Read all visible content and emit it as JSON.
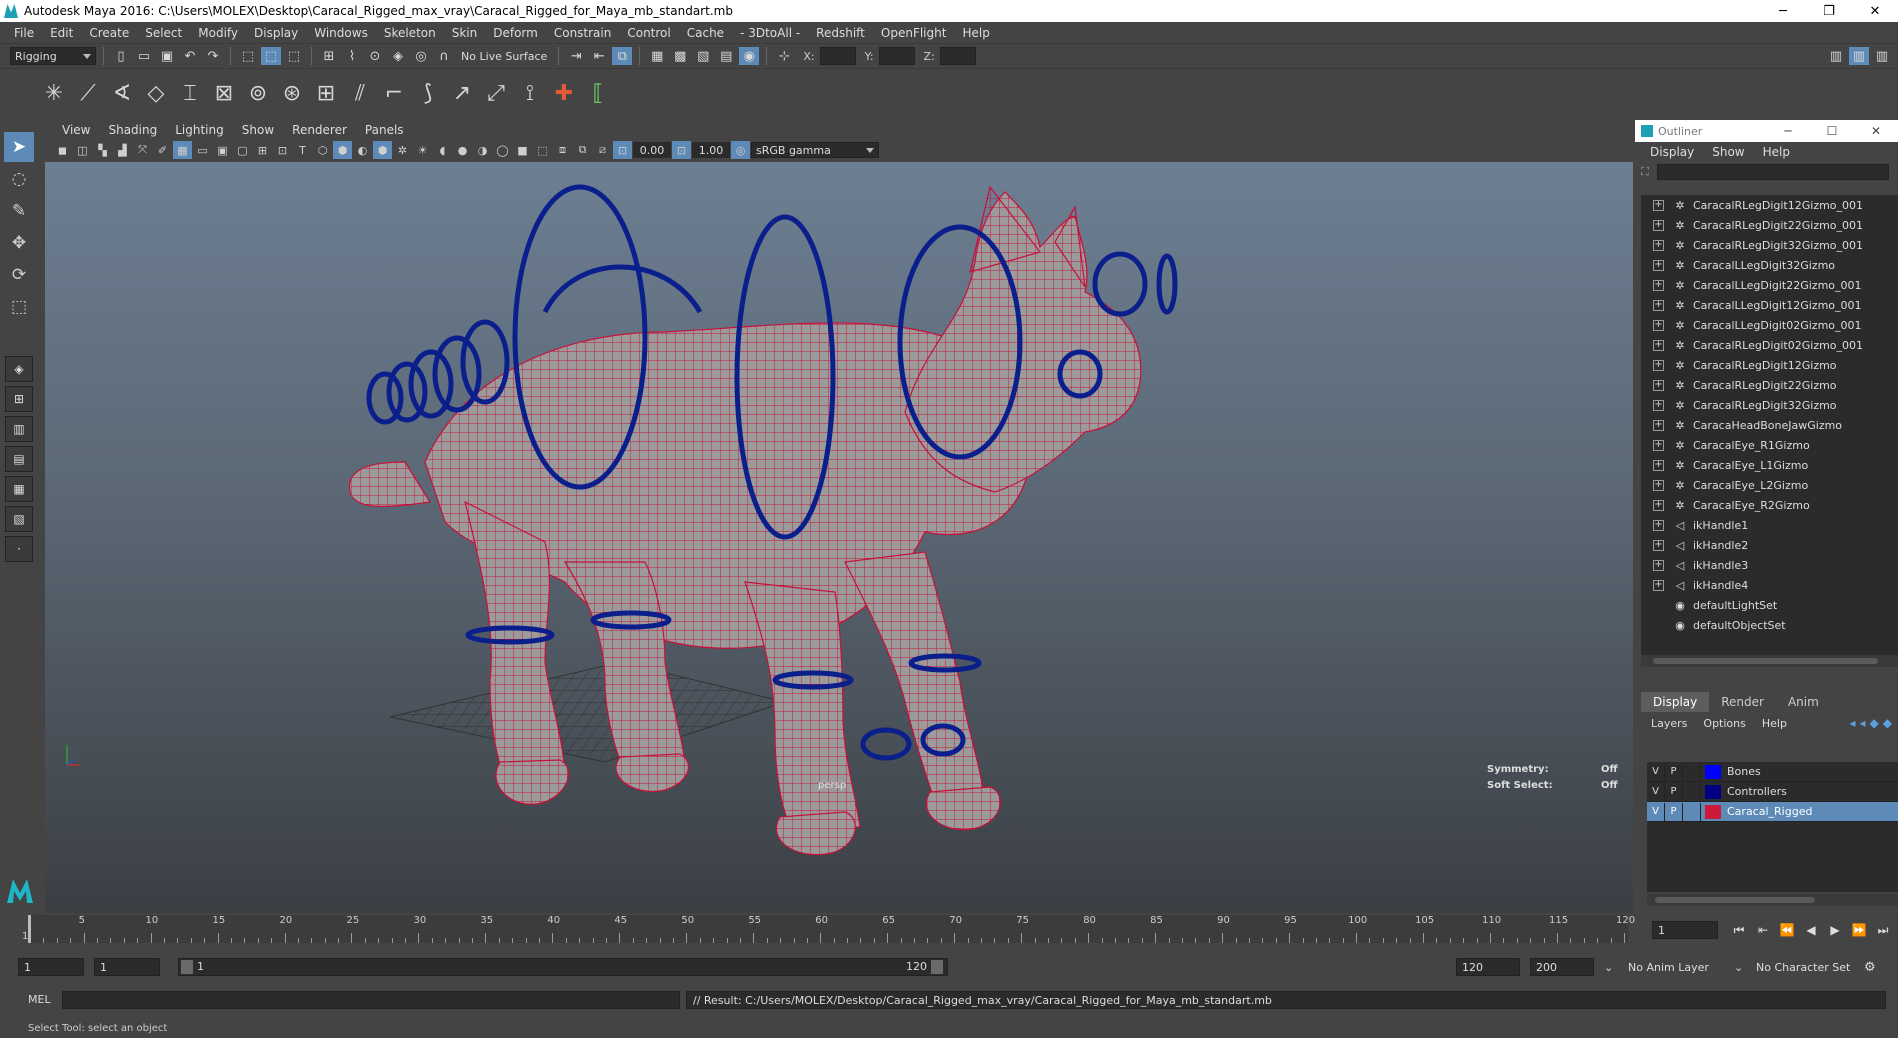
{
  "window": {
    "title": "Autodesk Maya 2016: C:\\Users\\MOLEX\\Desktop\\Caracal_Rigged_max_vray\\Caracal_Rigged_for_Maya_mb_standart.mb",
    "minimize": "─",
    "maximize": "❐",
    "close": "✕"
  },
  "menubar": [
    "File",
    "Edit",
    "Create",
    "Select",
    "Modify",
    "Display",
    "Windows",
    "Skeleton",
    "Skin",
    "Deform",
    "Constrain",
    "Control",
    "Cache",
    "- 3DtoAll -",
    "Redshift",
    "OpenFlight",
    "Help"
  ],
  "statusline": {
    "menuset": "Rigging",
    "live_surface": "No Live Surface",
    "x_label": "X:",
    "y_label": "Y:",
    "z_label": "Z:"
  },
  "viewport": {
    "menu": [
      "View",
      "Shading",
      "Lighting",
      "Show",
      "Renderer",
      "Panels"
    ],
    "near_value": "0.00",
    "far_value": "1.00",
    "color_space": "sRGB gamma",
    "camera_label": "persp",
    "hud": {
      "symmetry_label": "Symmetry:",
      "symmetry_value": "Off",
      "soft_select_label": "Soft Select:",
      "soft_select_value": "Off"
    }
  },
  "outliner": {
    "title": "Outliner",
    "menu": [
      "Display",
      "Show",
      "Help"
    ],
    "items": [
      {
        "label": "CaracalRLegDigit12Gizmo_001",
        "icon": "transform-icon",
        "expandable": true
      },
      {
        "label": "CaracalRLegDigit22Gizmo_001",
        "icon": "transform-icon",
        "expandable": true
      },
      {
        "label": "CaracalRLegDigit32Gizmo_001",
        "icon": "transform-icon",
        "expandable": true
      },
      {
        "label": "CaracalLLegDigit32Gizmo",
        "icon": "transform-icon",
        "expandable": true
      },
      {
        "label": "CaracalLLegDigit22Gizmo_001",
        "icon": "transform-icon",
        "expandable": true
      },
      {
        "label": "CaracalLLegDigit12Gizmo_001",
        "icon": "transform-icon",
        "expandable": true
      },
      {
        "label": "CaracalLLegDigit02Gizmo_001",
        "icon": "transform-icon",
        "expandable": true
      },
      {
        "label": "CaracalRLegDigit02Gizmo_001",
        "icon": "transform-icon",
        "expandable": true
      },
      {
        "label": "CaracalRLegDigit12Gizmo",
        "icon": "transform-icon",
        "expandable": true
      },
      {
        "label": "CaracalRLegDigit22Gizmo",
        "icon": "transform-icon",
        "expandable": true
      },
      {
        "label": "CaracalRLegDigit32Gizmo",
        "icon": "transform-icon",
        "expandable": true
      },
      {
        "label": "CaracaHeadBoneJawGizmo",
        "icon": "transform-icon",
        "expandable": true
      },
      {
        "label": "CaracalEye_R1Gizmo",
        "icon": "transform-icon",
        "expandable": true
      },
      {
        "label": "CaracalEye_L1Gizmo",
        "icon": "transform-icon",
        "expandable": true
      },
      {
        "label": "CaracalEye_L2Gizmo",
        "icon": "transform-icon",
        "expandable": true
      },
      {
        "label": "CaracalEye_R2Gizmo",
        "icon": "transform-icon",
        "expandable": true
      },
      {
        "label": "ikHandle1",
        "icon": "ik-handle-icon",
        "expandable": true
      },
      {
        "label": "ikHandle2",
        "icon": "ik-handle-icon",
        "expandable": true
      },
      {
        "label": "ikHandle3",
        "icon": "ik-handle-icon",
        "expandable": true
      },
      {
        "label": "ikHandle4",
        "icon": "ik-handle-icon",
        "expandable": true
      },
      {
        "label": "defaultLightSet",
        "icon": "set-icon",
        "expandable": false
      },
      {
        "label": "defaultObjectSet",
        "icon": "set-icon",
        "expandable": false
      }
    ]
  },
  "layer_editor": {
    "tabs": [
      "Display",
      "Render",
      "Anim"
    ],
    "active_tab": "Display",
    "menu": [
      "Layers",
      "Options",
      "Help"
    ],
    "layers": [
      {
        "visible": "V",
        "playback": "P",
        "name": "Bones",
        "color": "#0000ff",
        "selected": false
      },
      {
        "visible": "V",
        "playback": "P",
        "name": "Controllers",
        "color": "#000080",
        "selected": false
      },
      {
        "visible": "V",
        "playback": "P",
        "name": "Caracal_Rigged",
        "color": "#cc1a3a",
        "selected": true
      }
    ]
  },
  "timeslider": {
    "ticks": [
      5,
      10,
      15,
      20,
      25,
      30,
      35,
      40,
      45,
      50,
      55,
      60,
      65,
      70,
      75,
      80,
      85,
      90,
      95,
      100,
      105,
      110,
      115,
      120
    ],
    "first_label": "1",
    "min": 1,
    "max": 120,
    "current_frame": "1"
  },
  "rangeslider": {
    "start": "1",
    "playback_start": "1",
    "range_start_label": "1",
    "range_end_label": "120",
    "playback_end": "120",
    "end": "200",
    "anim_layer": "No Anim Layer",
    "character_set": "No Character Set"
  },
  "cmdline": {
    "language": "MEL",
    "result": "// Result: C:/Users/MOLEX/Desktop/Caracal_Rigged_max_vray/Caracal_Rigged_for_Maya_mb_standart.mb"
  },
  "helpline": "Select Tool: select an object",
  "colors": {
    "ui_bg": "#444444",
    "field_bg": "#2b2b2b",
    "active_blue": "#5d8ab7",
    "wireframe_red": "#c8103a",
    "controller_blue": "#0a1e8c"
  }
}
